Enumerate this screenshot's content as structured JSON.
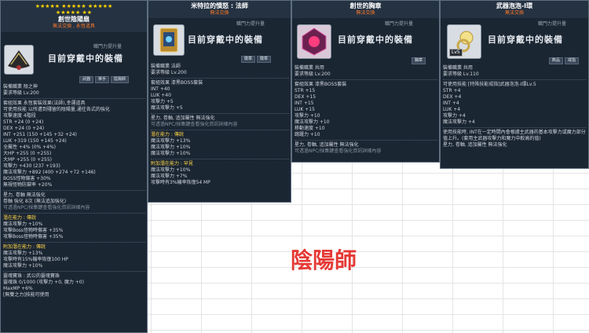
{
  "tip1": {
    "stars_row1": "★★★★★ ★★★★★ ★★★★★",
    "stars_row2": "★★★★★ ★★",
    "name": "創世陰陽扇",
    "trade": "無法交換 , 永恆道具",
    "rank": "職門力提升量",
    "equip_text": "目前穿戴中的裝備",
    "tags": [
      "武器",
      "單手",
      "陰陽師"
    ],
    "lines": [
      "裝備職業 陰之神",
      "要求等級 Lv.200",
      "套組效果 永恆套裝效果(法師),幸運道具",
      "可使用技能 以所遭到殘留的陰陽量,通往各式的強化",
      "攻擊速度 4階段",
      "STR +24 (0 +24)",
      "DEX +24 (0 +24)",
      "INT +251 (150 +145 +32 +24)",
      "LUK +319 (150 +145 +24)",
      "全屬性 +4% (0% +4%)",
      "大HP +255 (0 +255)",
      "大MP +255 (0 +255)",
      "攻擊力 +430 (237 +193)",
      "魔法攻擊力 +892 (400 +274 +72 +146)",
      "BOSS怪物傷害 +30%",
      "無視怪物防禦率 +20%",
      "星力, 卷軸 無法強化",
      "卷軸 強化 8次 (無法追加強化)",
      "可透過NPC/採集鍵查看強化資訊詳細內容"
    ],
    "pot_title": "潛在能力 : 傳說",
    "pot": [
      "魔法攻擊力 +10%",
      "攻擊Boss怪物時傷害 +35%",
      "攻擊Boss怪物時傷害 +35%"
    ],
    "add_title": "附加潛在能力 : 傳說",
    "add": [
      "魔法攻擊力 +13%",
      "攻擊時有15%機率恢復100 HP",
      "魔法攻擊力 +10%"
    ],
    "soul_title": "靈魂寶珠 : 武公的靈魂寶珠",
    "soul": [
      "靈魂珠 0/1000 (攻擊力 +0, 魔力 +0)",
      "MaxMP +6%",
      "[無雙之力]技能可使用"
    ]
  },
  "tip2": {
    "name": "米特拉的憤怒 : 法師",
    "trade": "無法交換",
    "rank": "職門力提升量",
    "equip_text": "目前穿戴中的裝備",
    "tags": [
      "徽章",
      "徽章"
    ],
    "lines": [
      "裝備職業 法師",
      "要求等級 Lv.200",
      "套組效果 漆黑BOSS套裝",
      "INT +40",
      "LUK +40",
      "攻擊力 +5",
      "魔法攻擊力 +5",
      "星力, 卷軸, 追加屬性 無法強化",
      "可透過NPC/採集鍵查看強化資訊詳細內容"
    ],
    "pot_title": "潛在能力 : 傳說",
    "pot": [
      "魔法攻擊力 +13%",
      "魔法攻擊力 +10%",
      "魔法攻擊力 +10%"
    ],
    "add_title": "附加潛在能力 : 罕見",
    "add": [
      "魔法攻擊力 +10%",
      "魔法攻擊力 +7%",
      "攻擊時有3%機率恢復54 MP"
    ]
  },
  "tip3": {
    "name": "創世的胸章",
    "trade": "無法交換",
    "rank": "職門力提升量",
    "equip_text": "目前穿戴中的裝備",
    "tags": [
      "胸章"
    ],
    "lines": [
      "裝備職業 共用",
      "要求等級 Lv.200",
      "套組效果 漆黑BOSS套裝",
      "STR +15",
      "DEX +15",
      "INT +15",
      "LUK +15",
      "攻擊力 +10",
      "魔法攻擊力 +10",
      "移動速度 +10",
      "跳躍力 +10",
      "星力, 卷軸, 追加屬性 無法強化",
      "可透過NPC/採集鍵查看強化資訊詳細內容"
    ]
  },
  "tip4": {
    "name": "武器泡泡-I環",
    "trade": "無法交換",
    "rank": "職門力提升量",
    "equip_text": "目前穿戴中的裝備",
    "badge": "Lv5",
    "tags": [
      "飾品",
      "戒指"
    ],
    "lines": [
      "裝備職業 共用",
      "要求等級 Lv.110",
      "可使用技能 [特殊技能戒指]武器泡泡-I環Lv.5",
      "STR +4",
      "DEX +4",
      "INT +4",
      "LUK +4",
      "攻擊力 +4",
      "魔法攻擊力 +4",
      "使用技能時, INT在一定時間內會根據主武器的基本攻擊力或魔力部分值上升。(套用主武器攻擊力和魔力中較高的值)",
      "星力, 卷軸, 追加屬性 無法強化"
    ]
  },
  "caption": "陰陽師"
}
